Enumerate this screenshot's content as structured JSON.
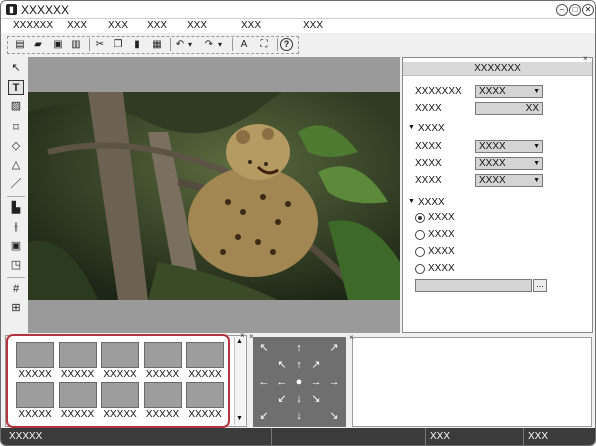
{
  "window": {
    "title": "XXXXXX"
  },
  "window_buttons": {
    "minimize": "–",
    "maximize": "□",
    "close": "✕"
  },
  "menu": [
    "XXXXXX",
    "XXX",
    "XXX",
    "XXX",
    "XXX",
    "XXX",
    "XXX"
  ],
  "toolbar": {
    "icons": [
      "new-file-icon",
      "open-folder-icon",
      "save-icon",
      "delete-icon",
      "cut-icon",
      "copy-icon",
      "paste-icon",
      "clipboard-icon",
      "undo-icon",
      "redo-icon",
      "font-icon",
      "capture-icon",
      "help-icon"
    ],
    "help_glyph": "?",
    "dropdown_glyph": "▾"
  },
  "left_tools": {
    "icons": [
      "select-arrow-icon",
      "text-tool-icon",
      "image-tool-icon",
      "rectangle-tool-icon",
      "pen-tool-icon",
      "shape-tool-icon",
      "line-tool-icon",
      "align-left-icon",
      "align-center-icon",
      "layer-order-icon",
      "group-icon",
      "grid-icon",
      "table-icon"
    ],
    "active": "text-tool-icon"
  },
  "properties": {
    "title": "XXXXXXX",
    "close_glyph": "×",
    "row1_label": "XXXXXXX",
    "row1_value": "XXXX",
    "row2_label": "XXXX",
    "row2_value": "XX",
    "section1": "XXXX",
    "section1_rows": [
      {
        "label": "XXXX",
        "value": "XXXX"
      },
      {
        "label": "XXXX",
        "value": "XXXX"
      },
      {
        "label": "XXXX",
        "value": "XXXX"
      }
    ],
    "section2": "XXXX",
    "radios": [
      {
        "label": "XXXX",
        "checked": true
      },
      {
        "label": "XXXX",
        "checked": false
      },
      {
        "label": "XXXX",
        "checked": false
      },
      {
        "label": "XXXX",
        "checked": false
      }
    ],
    "browse_label": "..."
  },
  "palette": {
    "thumbnails": [
      "XXXXX",
      "XXXXX",
      "XXXXX",
      "XXXXX",
      "XXXXX",
      "XXXXX",
      "XXXXX",
      "XXXXX",
      "XXXXX",
      "XXXXX"
    ],
    "highlight_color": "#b3343f"
  },
  "direction_pad": {
    "arrows": [
      "↖",
      "↑",
      "↗",
      "←",
      "●",
      "→",
      "↙",
      "↓",
      "↘"
    ]
  },
  "statusbar": {
    "left": "XXXXX",
    "mid": "XXX",
    "right": "XXX"
  },
  "colors": {
    "status_bg": "#3b3b3b",
    "dirpad_bg": "#6f6f6f",
    "viewer_bg": "#9a9a9a"
  }
}
